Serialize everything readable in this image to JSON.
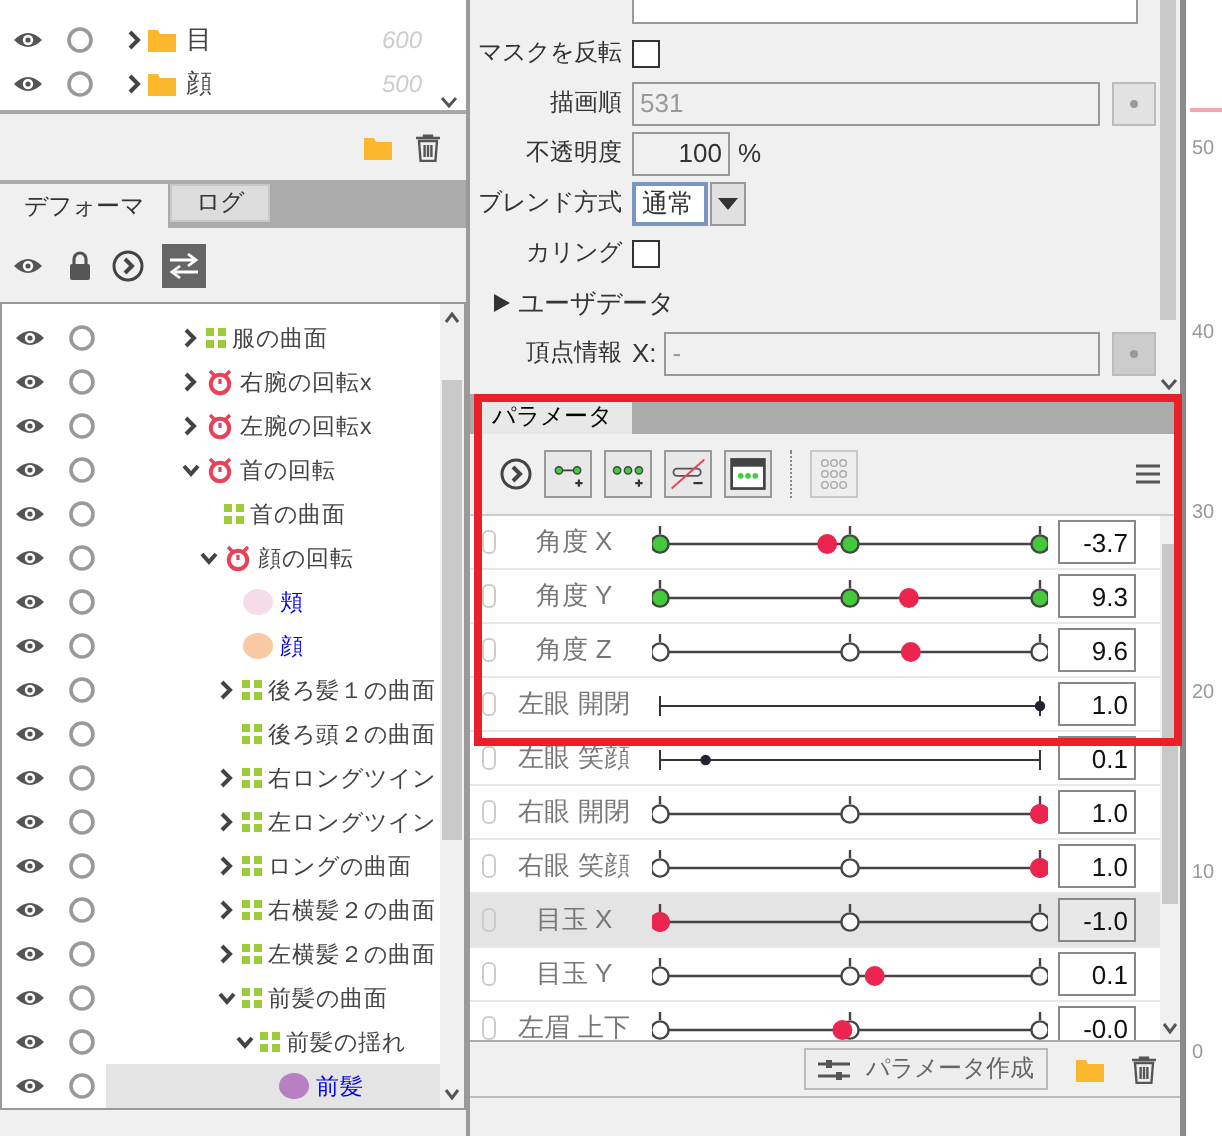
{
  "layers": [
    {
      "name": "目",
      "order": "600",
      "expanded": false
    },
    {
      "name": "顔",
      "order": "500",
      "expanded": false
    }
  ],
  "deformer_panel": {
    "tabs": [
      {
        "label": "デフォーマ",
        "selected": true
      },
      {
        "label": "ログ",
        "selected": false
      }
    ],
    "tree": [
      {
        "name": "服の曲面",
        "kind": "warp",
        "expanded": false,
        "selected": false
      },
      {
        "name": "右腕の回転x",
        "kind": "rotation",
        "expanded": false,
        "selected": false
      },
      {
        "name": "左腕の回転x",
        "kind": "rotation",
        "expanded": false,
        "selected": false
      },
      {
        "name": "首の回転",
        "kind": "rotation",
        "expanded": true,
        "selected": false,
        "children": [
          {
            "name": "首の曲面",
            "kind": "warp",
            "selected": false
          },
          {
            "name": "顔の回転",
            "kind": "rotation",
            "expanded": true,
            "selected": false,
            "children": [
              {
                "name": "頬",
                "kind": "mesh",
                "color": "#f6dbe9",
                "selected": false
              },
              {
                "name": "顔",
                "kind": "mesh",
                "color": "#f8c9a4",
                "selected": false
              },
              {
                "name": "後ろ髪１の曲面",
                "kind": "warp",
                "expanded": false,
                "selected": false
              },
              {
                "name": "後ろ頭２の曲面",
                "kind": "warp",
                "selected": false
              },
              {
                "name": "右ロングツイン",
                "kind": "warp",
                "expanded": false,
                "selected": false
              },
              {
                "name": "左ロングツイン",
                "kind": "warp",
                "expanded": false,
                "selected": false
              },
              {
                "name": "ロングの曲面",
                "kind": "warp",
                "expanded": false,
                "selected": false
              },
              {
                "name": "右横髪２の曲面",
                "kind": "warp",
                "expanded": false,
                "selected": false
              },
              {
                "name": "左横髪２の曲面",
                "kind": "warp",
                "expanded": false,
                "selected": false
              },
              {
                "name": "前髪の曲面",
                "kind": "warp",
                "expanded": true,
                "selected": false,
                "children": [
                  {
                    "name": "前髪の揺れ",
                    "kind": "warp",
                    "expanded": true,
                    "selected": false,
                    "children": [
                      {
                        "name": "前髪",
                        "kind": "mesh",
                        "color": "#b77fc4",
                        "selected": true
                      }
                    ]
                  }
                ]
              }
            ]
          }
        ]
      }
    ]
  },
  "inspector": {
    "fields": [
      {
        "kind": "checkbox",
        "label": "マスクを反転",
        "checked": false
      },
      {
        "kind": "text",
        "label": "描画順",
        "value": "531",
        "disabled": true
      },
      {
        "kind": "number",
        "label": "不透明度",
        "value": "100",
        "unit": "%"
      },
      {
        "kind": "select",
        "label": "ブレンド方式",
        "value": "通常"
      },
      {
        "kind": "checkbox",
        "label": "カリング",
        "checked": false
      },
      {
        "kind": "section",
        "label": "ユーザデータ",
        "expanded": false
      },
      {
        "kind": "vertex",
        "label": "頂点情報",
        "axis": "X:",
        "placeholder": "-"
      }
    ]
  },
  "parameter_panel": {
    "tabs": [
      {
        "label": "パラメータ",
        "selected": true
      }
    ],
    "tools": [
      {
        "kind": "play",
        "disabled": false
      },
      {
        "kind": "add-key",
        "disabled": false
      },
      {
        "kind": "add-three-keys",
        "disabled": false
      },
      {
        "kind": "delete-key",
        "disabled": false
      },
      {
        "kind": "panel",
        "disabled": false
      },
      {
        "kind": "grid",
        "disabled": true
      }
    ],
    "params": [
      {
        "name": "角度 X",
        "kind": "keyed",
        "keys_filled": true,
        "level": 0.44,
        "value": "-3.7",
        "selected": false
      },
      {
        "name": "角度 Y",
        "kind": "keyed",
        "keys_filled": true,
        "level": 0.655,
        "value": "9.3",
        "selected": false
      },
      {
        "name": "角度 Z",
        "kind": "keyed",
        "keys_filled": false,
        "level": 0.66,
        "value": "9.6",
        "selected": false
      },
      {
        "name": "左眼 開閉",
        "kind": "plain",
        "level": 1,
        "value": "1.0",
        "selected": false
      },
      {
        "name": "左眼 笑顔",
        "kind": "plain",
        "level": 0.12,
        "value": "0.1",
        "selected": false
      },
      {
        "name": "右眼 開閉",
        "kind": "keyed",
        "keys_filled": false,
        "level": 1,
        "value": "1.0",
        "selected": false
      },
      {
        "name": "右眼 笑顔",
        "kind": "keyed",
        "keys_filled": false,
        "level": 1,
        "value": "1.0",
        "selected": false
      },
      {
        "name": "目玉 X",
        "kind": "keyed",
        "keys_filled": false,
        "level": 0,
        "value": "-1.0",
        "selected": true
      },
      {
        "name": "目玉 Y",
        "kind": "keyed",
        "keys_filled": false,
        "level": 0.565,
        "value": "0.1",
        "selected": false
      },
      {
        "name": "左眉 上下",
        "kind": "keyed",
        "keys_filled": false,
        "level": 0.48,
        "value": "-0.0",
        "selected": false
      }
    ],
    "create_button": "パラメータ作成"
  },
  "ruler": {
    "labels": [
      "50",
      "40",
      "30",
      "20",
      "10",
      "0"
    ]
  }
}
